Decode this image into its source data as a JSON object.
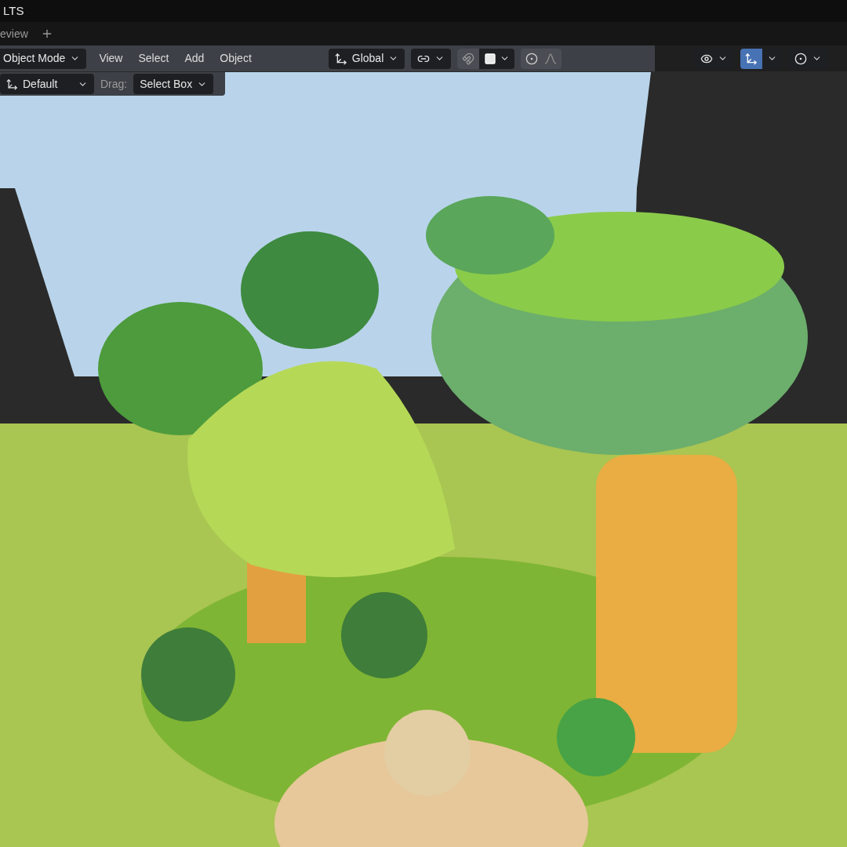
{
  "window": {
    "title": "LTS"
  },
  "tabs": [
    {
      "label": "eview",
      "selected": true
    }
  ],
  "header": {
    "mode": "Object Mode",
    "menus": [
      "View",
      "Select",
      "Add",
      "Object"
    ],
    "orientation": "Global",
    "snap_on": false,
    "proportional_on": false,
    "gizmo_on": true
  },
  "tool_settings": {
    "orientation": "Default",
    "drag_label": "Drag:",
    "drag_value": "Select Box"
  }
}
